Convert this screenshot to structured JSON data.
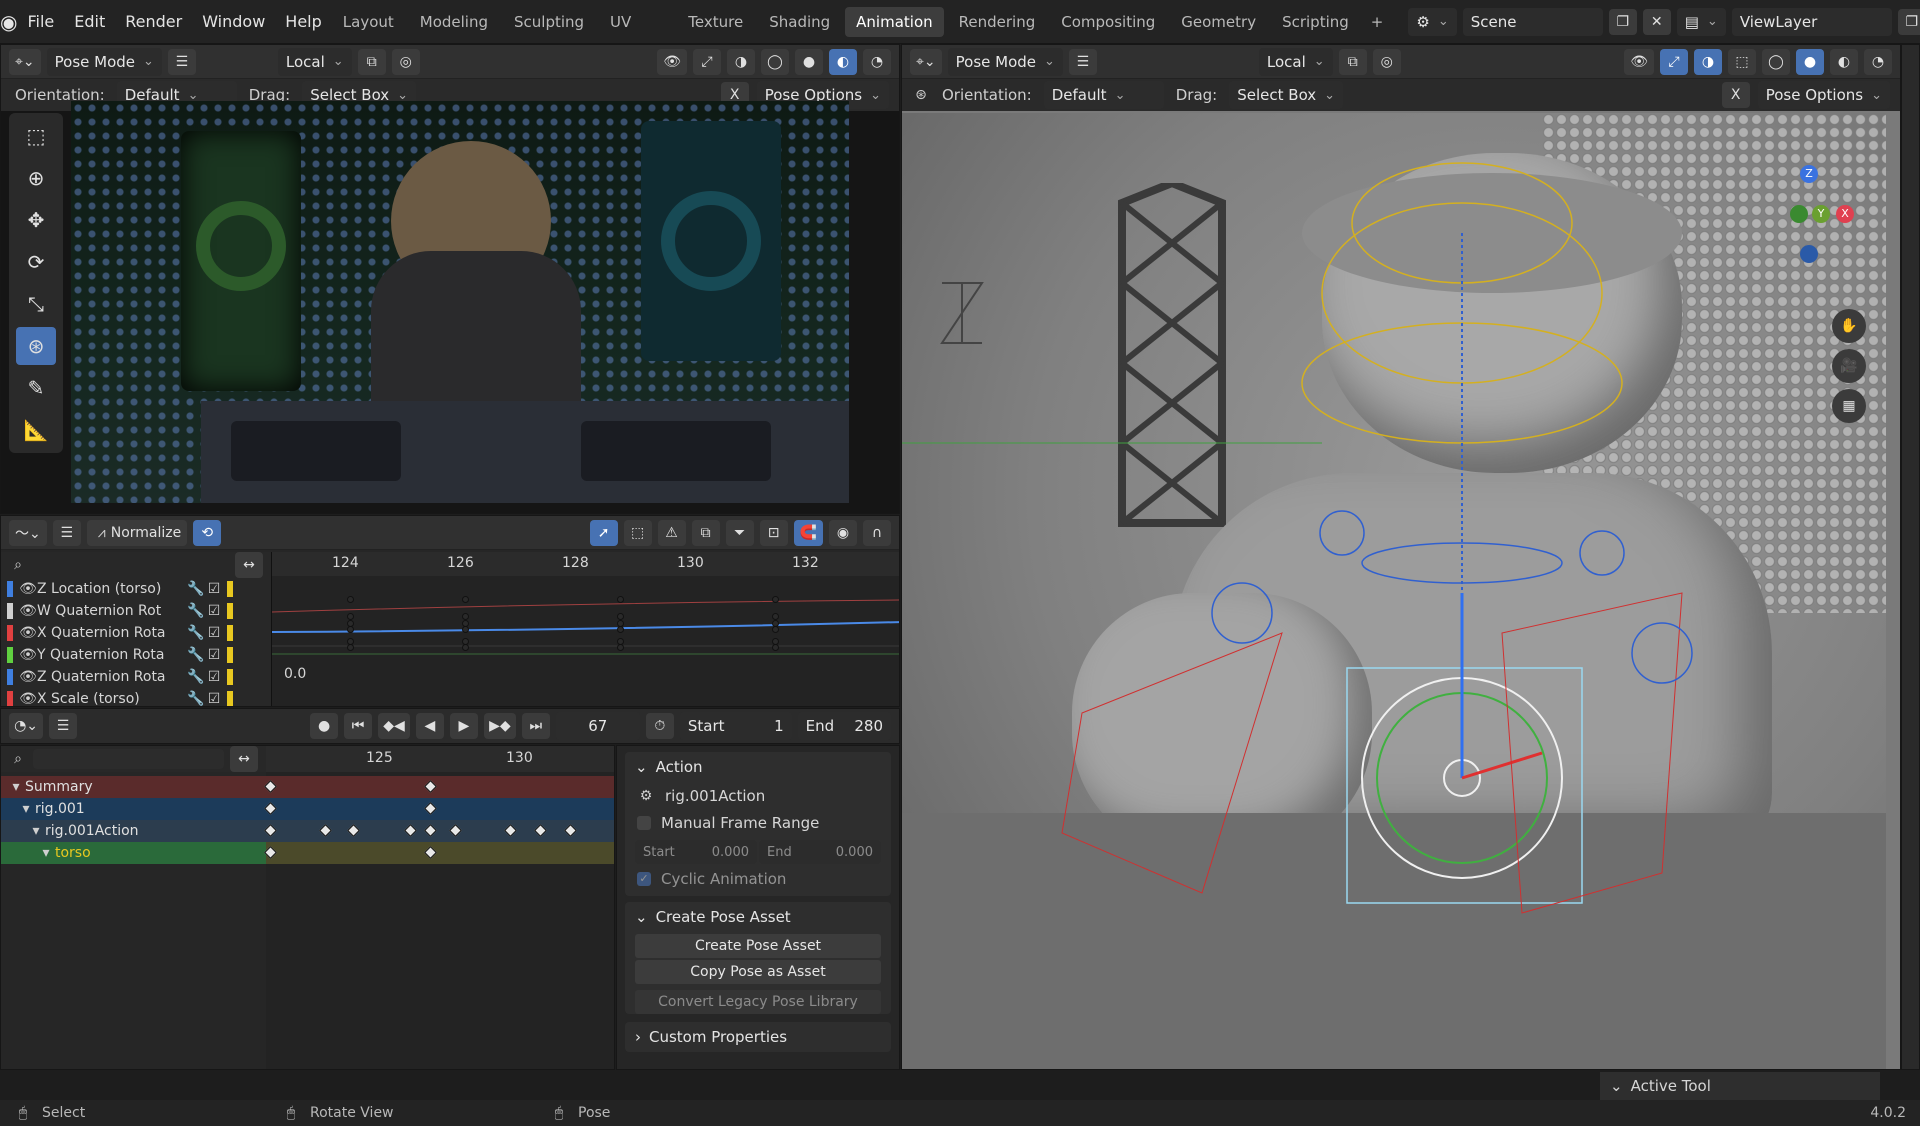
{
  "menus": [
    "File",
    "Edit",
    "Render",
    "Window",
    "Help"
  ],
  "workspaces": [
    "Layout",
    "Modeling",
    "Sculpting",
    "UV Editing",
    "Texture Paint",
    "Shading",
    "Animation",
    "Rendering",
    "Compositing",
    "Geometry Nodes",
    "Scripting"
  ],
  "active_workspace": "Animation",
  "scene": "Scene",
  "view_layer": "ViewLayer",
  "left_view": {
    "mode": "Pose Mode",
    "pivot": "Local",
    "orientation_label": "Orientation:",
    "orientation": "Default",
    "drag_label": "Drag:",
    "drag": "Select Box",
    "pose_options": "Pose Options",
    "x_label": "X"
  },
  "right_view": {
    "mode": "Pose Mode",
    "pivot": "Local",
    "orientation_label": "Orientation:",
    "orientation": "Default",
    "drag_label": "Drag:",
    "drag": "Select Box",
    "pose_options": "Pose Options",
    "x_label": "X"
  },
  "graph": {
    "normalize": "Normalize",
    "frames": [
      "124",
      "126",
      "128",
      "130",
      "132"
    ],
    "value_label": "0.0",
    "channels": [
      {
        "name": "Z Location (torso)",
        "color": "#3f7fe0"
      },
      {
        "name": "W Quaternion Rot",
        "color": "#d0d0d0"
      },
      {
        "name": "X Quaternion Rota",
        "color": "#e04040"
      },
      {
        "name": "Y Quaternion Rota",
        "color": "#60d040"
      },
      {
        "name": "Z Quaternion Rota",
        "color": "#3f7fe0"
      },
      {
        "name": "X Scale (torso)",
        "color": "#e04040"
      }
    ]
  },
  "timeline": {
    "current_frame": "67",
    "start_label": "Start",
    "start": "1",
    "end_label": "End",
    "end": "280"
  },
  "dopesheet": {
    "frames": [
      "125",
      "130"
    ],
    "rows": [
      {
        "name": "Summary",
        "type": "summary"
      },
      {
        "name": "rig.001",
        "type": "object"
      },
      {
        "name": "rig.001Action",
        "type": "action"
      },
      {
        "name": "torso",
        "type": "group"
      }
    ]
  },
  "action_panel": {
    "title": "Action",
    "action_name": "rig.001Action",
    "manual_range": "Manual Frame Range",
    "start_label": "Start",
    "start_val": "0.000",
    "end_label": "End",
    "end_val": "0.000",
    "cyclic": "Cyclic Animation"
  },
  "pose_panel": {
    "title": "Create Pose Asset",
    "create": "Create Pose Asset",
    "copy": "Copy Pose as Asset",
    "convert": "Convert Legacy Pose Library"
  },
  "custom_props": "Custom Properties",
  "active_tool": "Active Tool",
  "status": {
    "select": "Select",
    "rotate": "Rotate View",
    "pose": "Pose",
    "version": "4.0.2"
  },
  "gizmo": {
    "z": "Z",
    "y": "Y",
    "x": "X"
  }
}
